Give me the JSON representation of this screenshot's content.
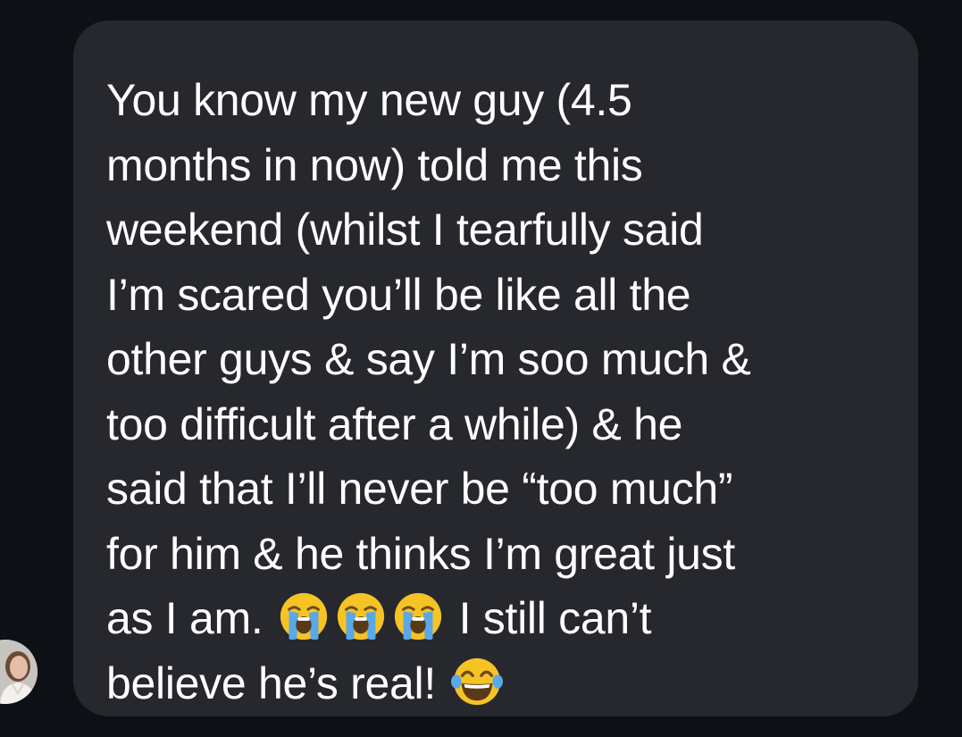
{
  "message": {
    "lines": [
      "You know my new guy (4.5",
      "months in now) told me this",
      "weekend (whilst I tearfully said",
      "I’m scared you’ll be like all the",
      "other guys & say I’m soo much &",
      "too difficult after a while) & he",
      "said that I’ll never be “too much”",
      "for him & he thinks I’m great just"
    ],
    "line9_text_a": "as I am.",
    "line9_text_b": "I still can’t",
    "line10_text": "believe he’s real!",
    "emojis": [
      "loudly-crying-face",
      "loudly-crying-face",
      "loudly-crying-face",
      "face-with-tears-of-joy"
    ]
  },
  "colors": {
    "background": "#0d1015",
    "bubble": "#26282d",
    "text": "#ffffff",
    "emoji_yellow": "#f6c325"
  }
}
